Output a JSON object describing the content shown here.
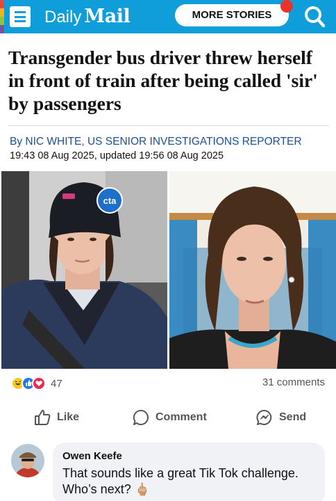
{
  "header": {
    "logo_part1": "Daily",
    "logo_part2": "Mail",
    "more_stories_label": "MORE STORIES",
    "colors": {
      "bar": "#0f9ed9",
      "notification": "#e8342a"
    }
  },
  "article": {
    "headline": "Transgender bus driver threw herself in front of train after being called 'sir' by passengers",
    "byline_prefix": "By",
    "byline_author": "NIC WHITE, US SENIOR INVESTIGATIONS REPORTER",
    "dates": "19:43 08 Aug 2025, updated 19:56 08 Aug 2025",
    "photo_left_badge": "cta"
  },
  "social": {
    "reaction_icons": [
      "haha-icon",
      "like-icon",
      "love-icon"
    ],
    "reaction_count": "47",
    "comments_count": "31 comments",
    "actions": {
      "like": "Like",
      "comment": "Comment",
      "send": "Send"
    }
  },
  "comment": {
    "author": "Owen Keefe",
    "text": "That sounds like a great Tik Tok challenge. Who’s next?",
    "emoji": "🖕🏼"
  }
}
